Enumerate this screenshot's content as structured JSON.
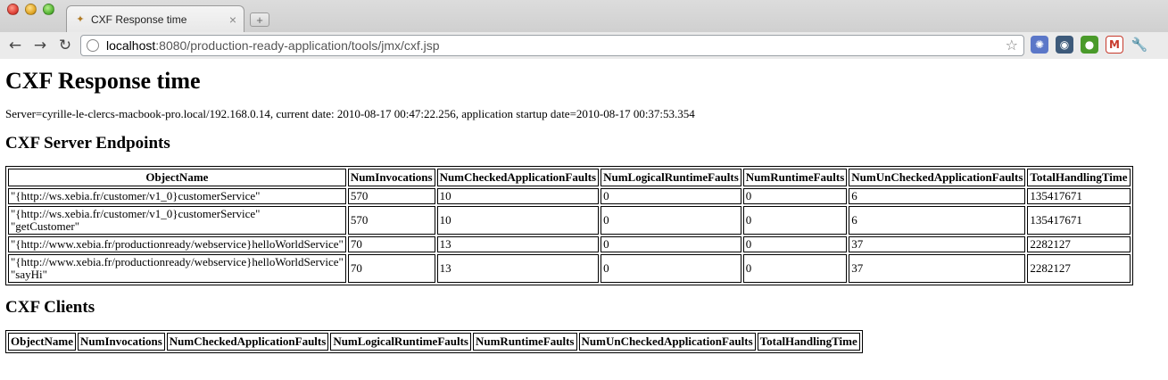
{
  "browser": {
    "tab_title": "CXF Response time",
    "new_tab_label": "+",
    "url_host": "localhost",
    "url_path": ":8080/production-ready-application/tools/jmx/cxf.jsp"
  },
  "page": {
    "title": "CXF Response time",
    "info": "Server=cyrille-le-clercs-macbook-pro.local/192.168.0.14, current date: 2010-08-17 00:47:22.256, application startup date=2010-08-17 00:37:53.354",
    "server_section_title": "CXF Server Endpoints",
    "client_section_title": "CXF Clients"
  },
  "server_table": {
    "headers": [
      "ObjectName",
      "NumInvocations",
      "NumCheckedApplicationFaults",
      "NumLogicalRuntimeFaults",
      "NumRuntimeFaults",
      "NumUnCheckedApplicationFaults",
      "TotalHandlingTime"
    ],
    "rows": [
      [
        "\"{http://ws.xebia.fr/customer/v1_0}customerService\"",
        "570",
        "10",
        "0",
        "0",
        "6",
        "135417671"
      ],
      [
        "\"{http://ws.xebia.fr/customer/v1_0}customerService\"\n\"getCustomer\"",
        "570",
        "10",
        "0",
        "0",
        "6",
        "135417671"
      ],
      [
        "\"{http://www.xebia.fr/productionready/webservice}helloWorldService\"",
        "70",
        "13",
        "0",
        "0",
        "37",
        "2282127"
      ],
      [
        "\"{http://www.xebia.fr/productionready/webservice}helloWorldService\"\n\"sayHi\"",
        "70",
        "13",
        "0",
        "0",
        "37",
        "2282127"
      ]
    ]
  },
  "client_table": {
    "headers": [
      "ObjectName",
      "NumInvocations",
      "NumCheckedApplicationFaults",
      "NumLogicalRuntimeFaults",
      "NumRuntimeFaults",
      "NumUnCheckedApplicationFaults",
      "TotalHandlingTime"
    ]
  }
}
